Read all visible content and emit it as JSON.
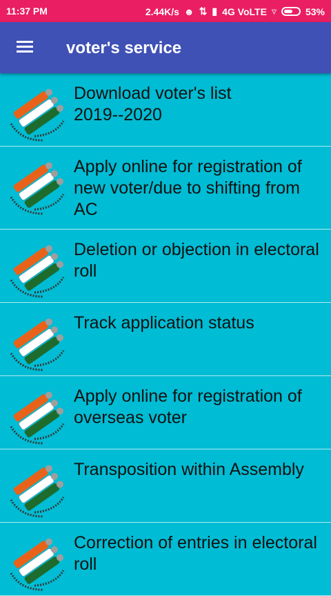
{
  "status_bar": {
    "time": "11:37 PM",
    "speed": "2.44K/s",
    "network": "4G VoLTE",
    "battery": "53%",
    "icons": [
      "headphones-icon",
      "data-arrows-icon",
      "signal-icon",
      "no-signal-icon",
      "battery-icon"
    ]
  },
  "app_bar": {
    "title": "voter's service",
    "menu_icon": "hamburger-menu-icon"
  },
  "items": [
    {
      "label": "Download voter's  list\n2019--2020",
      "icon": "election-commission-logo-icon"
    },
    {
      "label": "Apply online for registration of new voter/due to shifting from AC",
      "icon": "election-commission-logo-icon"
    },
    {
      "label": "Deletion or objection in electoral roll",
      "icon": "election-commission-logo-icon"
    },
    {
      "label": "Track application status",
      "icon": "election-commission-logo-icon"
    },
    {
      "label": "Apply online for registration of overseas voter",
      "icon": "election-commission-logo-icon"
    },
    {
      "label": "Transposition within Assembly",
      "icon": "election-commission-logo-icon"
    },
    {
      "label": "Correction of entries in electoral roll",
      "icon": "election-commission-logo-icon"
    }
  ],
  "colors": {
    "status_bar": "#E91E63",
    "app_bar": "#3F51B5",
    "background": "#00BCD4",
    "saffron": "#E8621A",
    "green": "#1E6B2E"
  }
}
